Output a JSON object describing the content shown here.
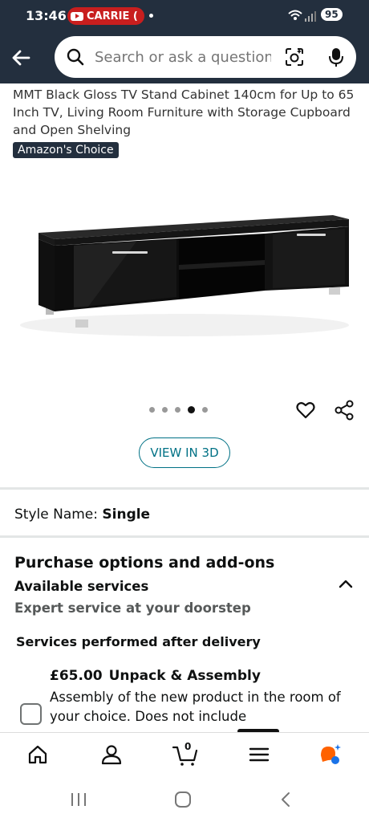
{
  "status": {
    "time": "13:46",
    "notification": "CARRIE (",
    "battery": "95"
  },
  "search": {
    "placeholder": "Search or ask a question"
  },
  "product": {
    "title": "MMT Black Gloss TV Stand Cabinet 140cm for Up to 65 Inch TV, Living Room Furniture with Storage Cupboard and Open Shelving",
    "badge": "Amazon's Choice",
    "image_count": 5,
    "active_image_index": 3
  },
  "view3d": {
    "label": "VIEW IN 3D"
  },
  "style": {
    "label": "Style Name: ",
    "value": "Single"
  },
  "purchase": {
    "title": "Purchase options and add-ons",
    "available_services": "Available services",
    "expert": "Expert service at your doorstep",
    "performed": "Services performed after delivery",
    "service": {
      "price": "£65.00",
      "name": "Unpack & Assembly",
      "description": "Assembly of the new product in the room of your choice. Does not include",
      "checked": false
    }
  },
  "nav": {
    "cart_count": "0"
  },
  "colors": {
    "header_bg": "#232f3e",
    "link": "#007185",
    "accent": "#ff6200"
  }
}
